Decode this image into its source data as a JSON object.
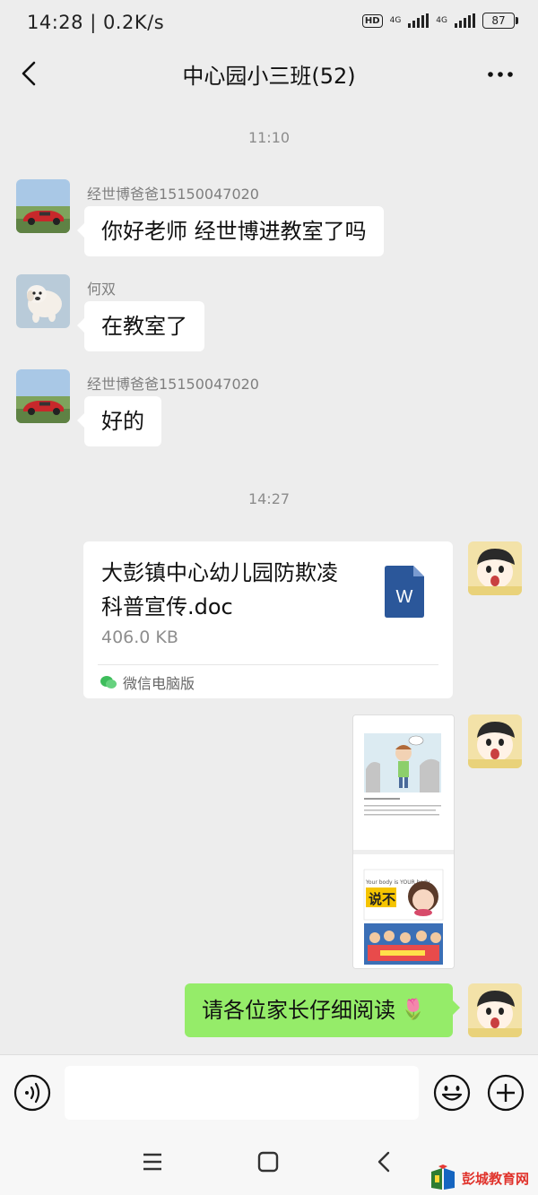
{
  "status": {
    "time": "14:28 | 0.2K/s",
    "hd": "HD",
    "net1": "4G",
    "net2": "4G",
    "battery": "87"
  },
  "header": {
    "title": "中心园小三班(52)"
  },
  "timestamps": [
    "11:10",
    "14:27"
  ],
  "messages": [
    {
      "sender": "经世博爸爸15150047020",
      "text": "你好老师 经世博进教室了吗"
    },
    {
      "sender": "何双",
      "text": "在教室了"
    },
    {
      "sender": "经世博爸爸15150047020",
      "text": "好的"
    }
  ],
  "file": {
    "name_line1": "大彭镇中心幼儿园防欺凌",
    "name_line2": "科普宣传.doc",
    "size": "406.0 KB",
    "source": "微信电脑版",
    "icon_letter": "W"
  },
  "image_message": {
    "text1": "说不",
    "text2": "Your body is YOUR body"
  },
  "my_message": {
    "text": "请各位家长仔细阅读",
    "emoji": "🌷"
  },
  "watermark": {
    "text": "彭城教育网"
  },
  "colors": {
    "background": "#ededed",
    "bubble_white": "#ffffff",
    "bubble_green": "#95ec69",
    "doc_blue": "#2b579a"
  }
}
